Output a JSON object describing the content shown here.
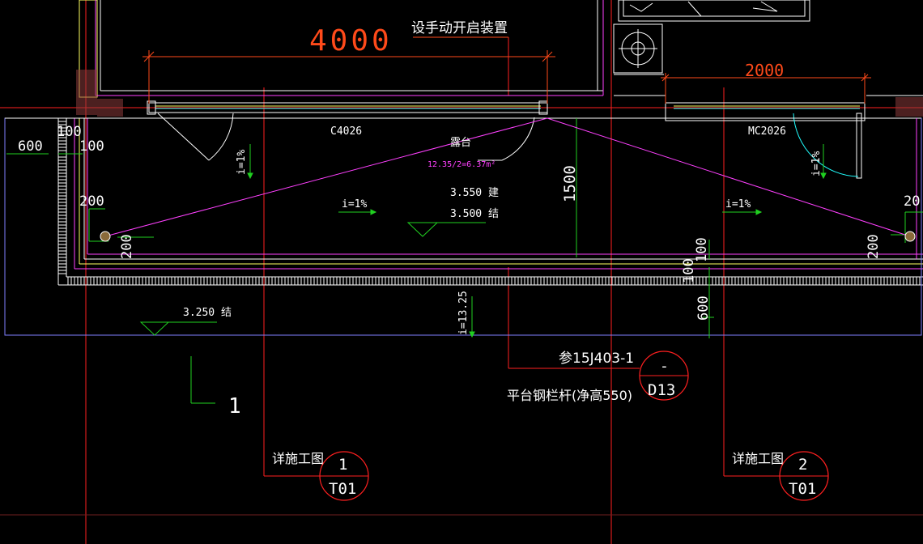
{
  "drawing": {
    "dims": {
      "d4000": "4000",
      "d2000": "2000",
      "d1500": "1500",
      "d600_left": "600",
      "d100_a": "100",
      "d100_b": "100",
      "d200_left": "200",
      "d200_right": "20",
      "d200_vleft": "200",
      "d200_vright": "200",
      "d100_v1": "100",
      "d100_v2": "100",
      "d600_v": "600"
    },
    "labels": {
      "manual_open": "设手动开启装置",
      "window_c4026": "C4026",
      "door_mc2026": "MC2026",
      "terrace": "露台",
      "terrace_area": "12.35/2=6.37m²",
      "elev_arch": "3.550 建",
      "elev_struct": "3.500 结",
      "elev_lower": "3.250 结",
      "slope_left": "i=1%",
      "slope_mid": "i=1%",
      "slope_right": "i=1%",
      "slope_v_left": "i=1%",
      "slope_v_right": "i=1%",
      "slope_v_mid": "i=13.25",
      "ref_std": "参15J403-1",
      "railing": "平台钢栏杆(净高550)",
      "axis_1": "1",
      "detail_ref_1": "详施工图",
      "detail_ref_2": "详施工图"
    },
    "bubbles": {
      "d13_top": "-",
      "d13_bottom": "D13",
      "t01_1_top": "1",
      "t01_1_bottom": "T01",
      "t01_2_top": "2",
      "t01_2_bottom": "T01"
    },
    "colors": {
      "background": "#000000",
      "dimension": "#ff4a1a",
      "red_line": "#ff2020",
      "magenta": "#ff40ff",
      "white": "#ffffff",
      "green": "#20d020",
      "yellow": "#ffff60",
      "cyan": "#20ffff",
      "blue_outline": "#8080ff"
    },
    "icons": [
      "circle-crosshair-icon",
      "drain-icon",
      "elevation-triangle-icon"
    ]
  }
}
